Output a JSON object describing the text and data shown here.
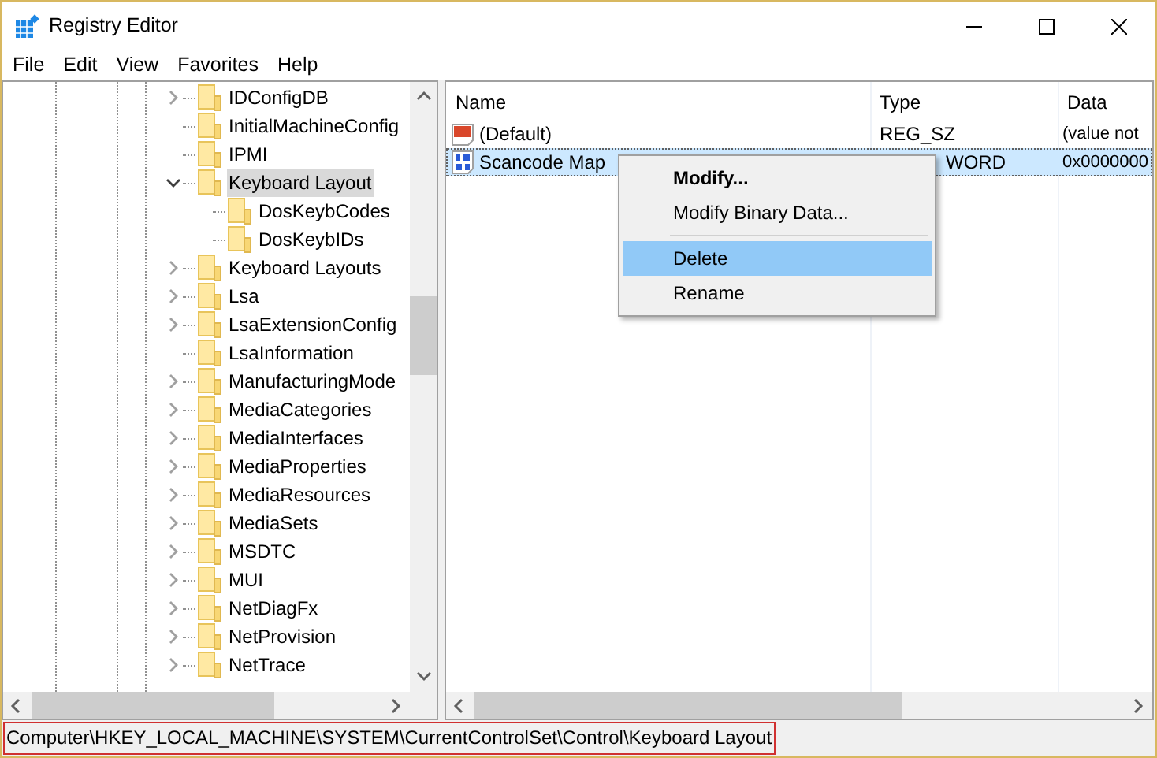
{
  "window": {
    "title": "Registry Editor"
  },
  "menu": [
    "File",
    "Edit",
    "View",
    "Favorites",
    "Help"
  ],
  "tree": [
    {
      "label": "IDConfigDB",
      "expanded": false,
      "selected": false
    },
    {
      "label": "InitialMachineConfig",
      "selected": false
    },
    {
      "label": "IPMI",
      "selected": false
    },
    {
      "label": "Keyboard Layout",
      "expanded": true,
      "selected": true,
      "children": [
        {
          "label": "DosKeybCodes",
          "selected": false
        },
        {
          "label": "DosKeybIDs",
          "selected": false
        }
      ]
    },
    {
      "label": "Keyboard Layouts",
      "expanded": false,
      "selected": false
    },
    {
      "label": "Lsa",
      "expanded": false,
      "selected": false
    },
    {
      "label": "LsaExtensionConfig",
      "expanded": false,
      "selected": false
    },
    {
      "label": "LsaInformation",
      "selected": false
    },
    {
      "label": "ManufacturingMode",
      "expanded": false,
      "selected": false
    },
    {
      "label": "MediaCategories",
      "expanded": false,
      "selected": false
    },
    {
      "label": "MediaInterfaces",
      "expanded": false,
      "selected": false
    },
    {
      "label": "MediaProperties",
      "expanded": false,
      "selected": false
    },
    {
      "label": "MediaResources",
      "expanded": false,
      "selected": false
    },
    {
      "label": "MediaSets",
      "expanded": false,
      "selected": false
    },
    {
      "label": "MSDTC",
      "expanded": false,
      "selected": false
    },
    {
      "label": "MUI",
      "expanded": false,
      "selected": false
    },
    {
      "label": "NetDiagFx",
      "expanded": false,
      "selected": false
    },
    {
      "label": "NetProvision",
      "expanded": false,
      "selected": false
    },
    {
      "label": "NetTrace",
      "expanded": false,
      "selected": false
    }
  ],
  "table": {
    "columns": [
      "Name",
      "Type",
      "Data"
    ],
    "rows": [
      {
        "kind": "string",
        "name": "(Default)",
        "type": "REG_SZ",
        "data": "(value not",
        "selected": false
      },
      {
        "kind": "binary",
        "name": "Scancode Map",
        "type": "WORD",
        "data": "0x0000000",
        "selected": true
      }
    ]
  },
  "context_menu": [
    {
      "kind": "item",
      "label": "Modify...",
      "default": true,
      "selected": false
    },
    {
      "kind": "item",
      "label": "Modify Binary Data...",
      "default": false,
      "selected": false
    },
    {
      "kind": "separator"
    },
    {
      "kind": "item",
      "label": "Delete",
      "default": false,
      "selected": true
    },
    {
      "kind": "item",
      "label": "Rename",
      "default": false,
      "selected": false
    }
  ],
  "status_bar": "Computer\\HKEY_LOCAL_MACHINE\\SYSTEM\\CurrentControlSet\\Control\\Keyboard Layout"
}
